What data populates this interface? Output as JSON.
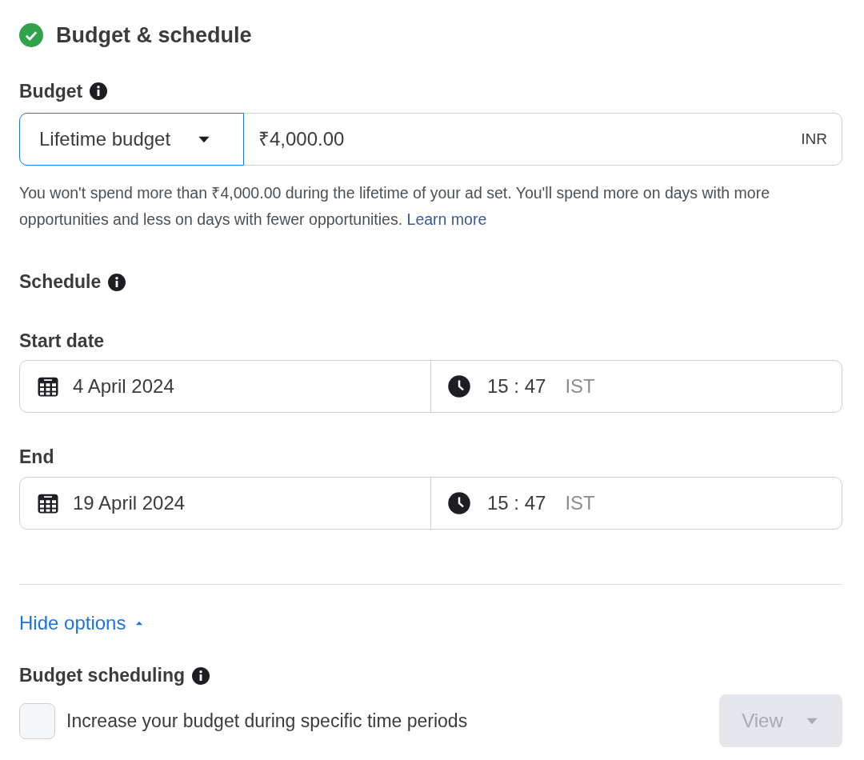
{
  "section": {
    "title": "Budget & schedule",
    "complete": true
  },
  "budget": {
    "label": "Budget",
    "type": {
      "value": "Lifetime budget",
      "focused": true
    },
    "amount": "₹4,000.00",
    "currency": "INR",
    "help": "You won't spend more than ₹4,000.00 during the lifetime of your ad set. You'll spend more on days with more opportunities and less on days with fewer opportunities.",
    "link": "Learn more"
  },
  "schedule": {
    "label": "Schedule",
    "fields": [
      {
        "label": "Start date",
        "date": "4 April 2024",
        "hour": "15",
        "separator": ":",
        "minute": "47",
        "zone": "IST"
      },
      {
        "label": "End",
        "date": "19 April 2024",
        "hour": "15",
        "separator": ":",
        "minute": "47",
        "zone": "IST"
      }
    ]
  },
  "options_toggle": {
    "label": "Hide options",
    "expanded": true
  },
  "budget_scheduling": {
    "label": "Budget scheduling",
    "checkbox": {
      "label": "Increase your budget during specific time periods",
      "checked": false
    },
    "view_button": {
      "label": "View",
      "disabled": true
    }
  }
}
